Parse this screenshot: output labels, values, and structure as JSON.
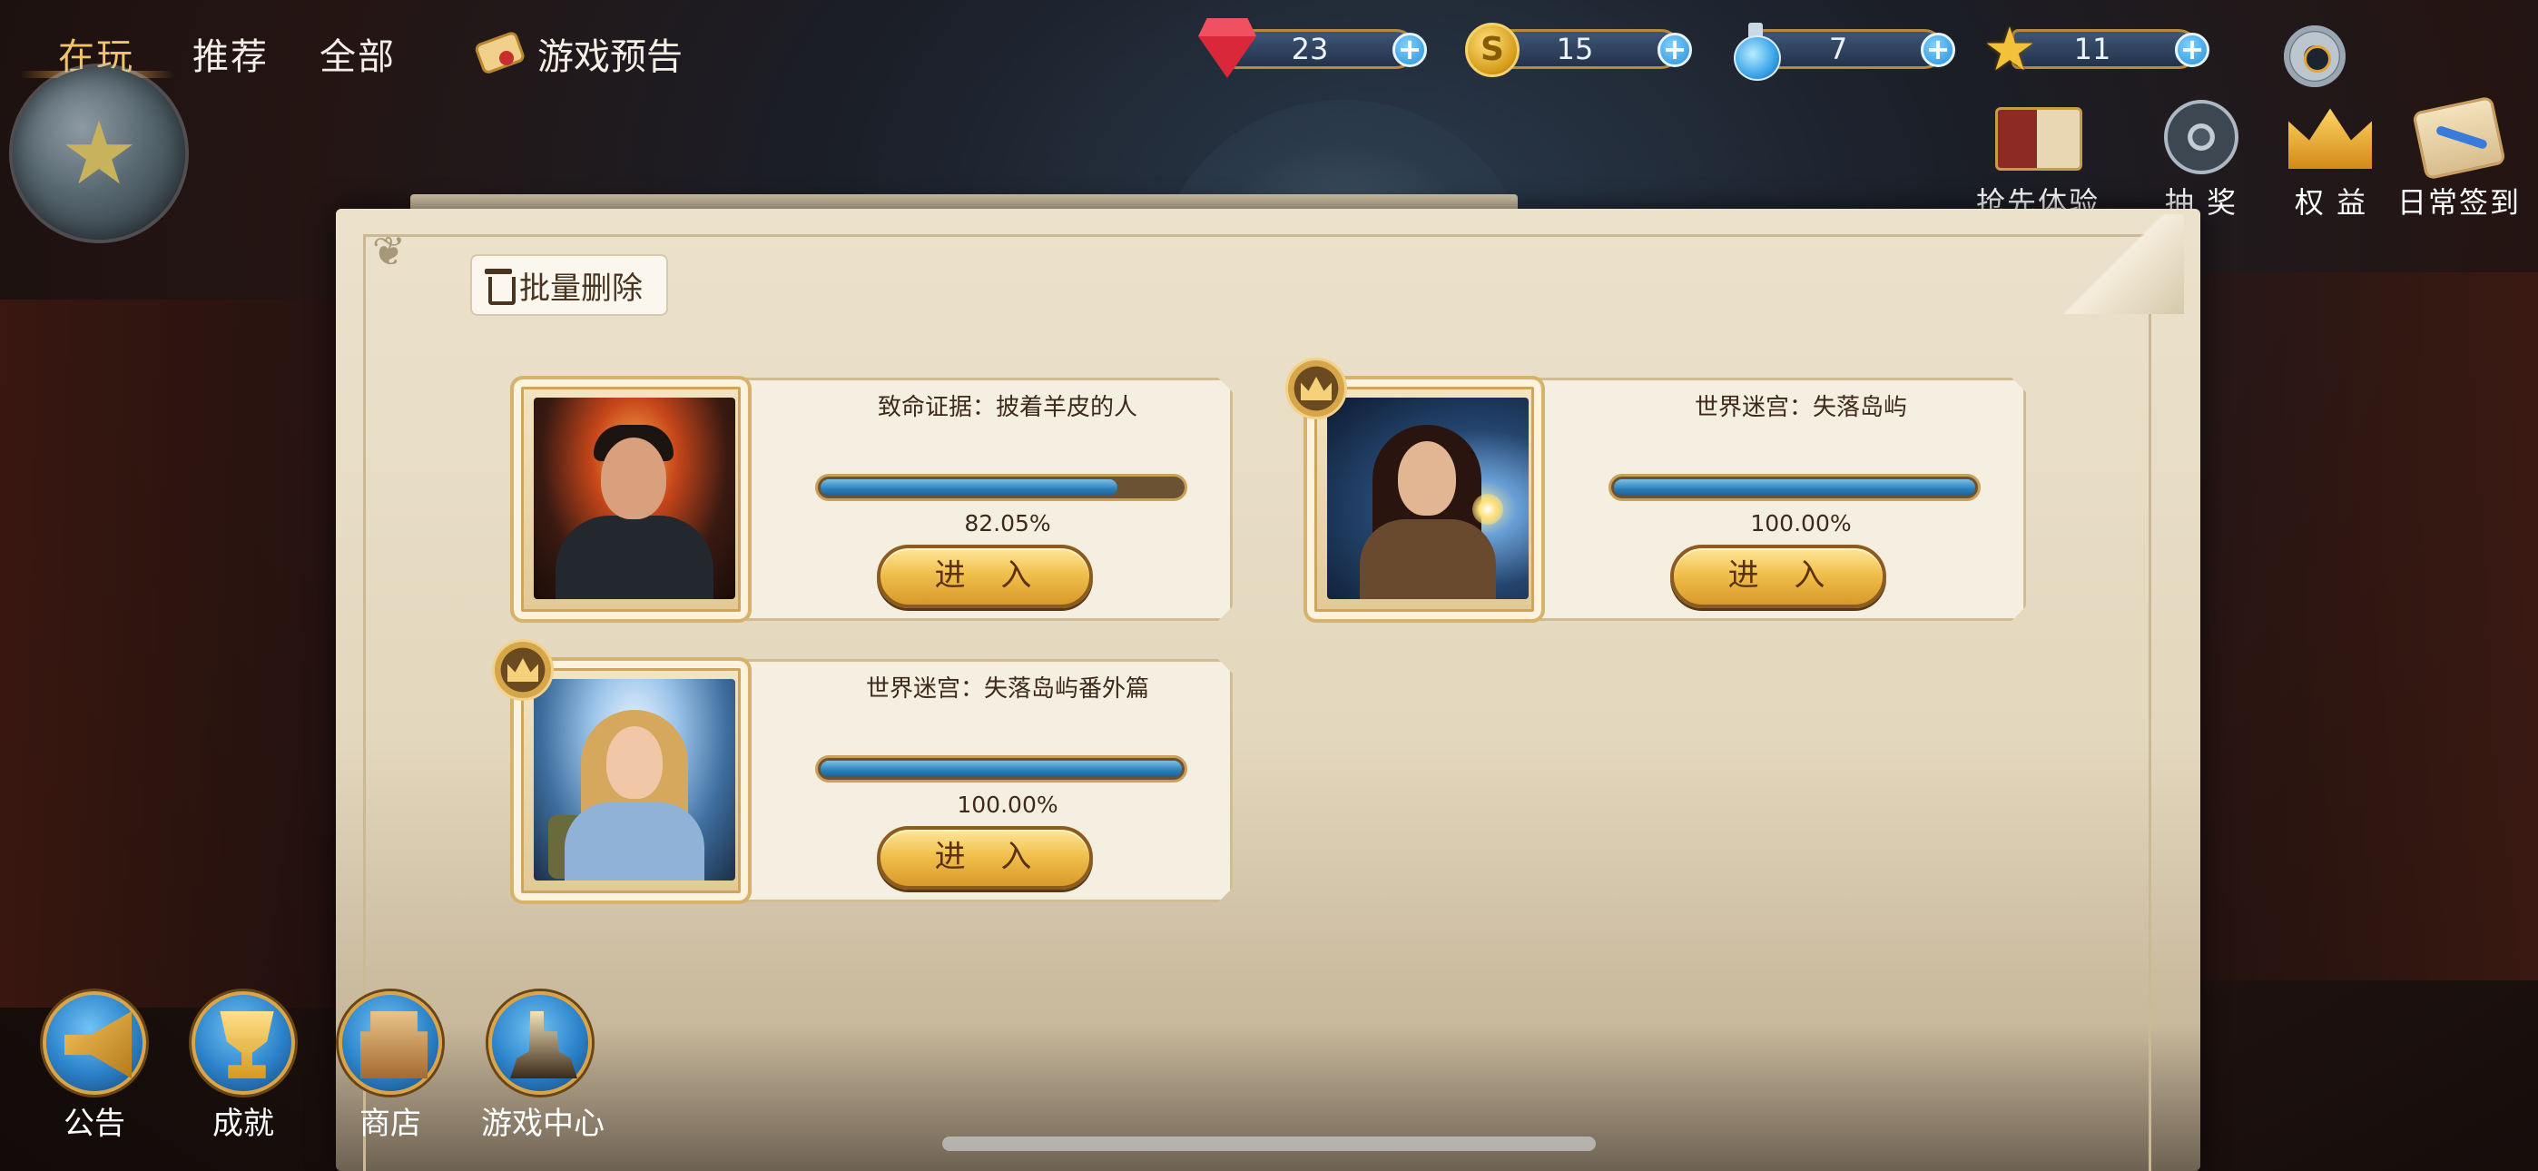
{
  "tabs": [
    {
      "label": "在玩",
      "active": true
    },
    {
      "label": "推荐",
      "active": false
    },
    {
      "label": "全部",
      "active": false
    }
  ],
  "preview_tab": {
    "label": "游戏预告",
    "icon": "scroll-icon"
  },
  "currencies": [
    {
      "icon": "ruby-gem-icon",
      "value": "23"
    },
    {
      "icon": "gold-coin-icon",
      "value": "15"
    },
    {
      "icon": "potion-icon",
      "value": "7"
    },
    {
      "icon": "star-icon",
      "value": "11"
    }
  ],
  "features": [
    {
      "label": "抢先体验",
      "icon": "book-icon"
    },
    {
      "label": "抽 奖",
      "icon": "film-reel-icon"
    },
    {
      "label": "权 益",
      "icon": "crown-icon"
    },
    {
      "label": "日常签到",
      "icon": "scroll-quill-icon"
    }
  ],
  "batch_delete_label": "批量删除",
  "games": [
    {
      "title": "致命证据：披着羊皮的人",
      "progress": 82.05,
      "progress_label": "82.05%",
      "enter_label": "进 入",
      "vip": false
    },
    {
      "title": "世界迷宫：失落岛屿",
      "progress": 100,
      "progress_label": "100.00%",
      "enter_label": "进 入",
      "vip": true
    },
    {
      "title": "世界迷宫：失落岛屿番外篇",
      "progress": 100,
      "progress_label": "100.00%",
      "enter_label": "进 入",
      "vip": true
    }
  ],
  "bottom_nav": [
    {
      "label": "公告",
      "icon": "megaphone-icon"
    },
    {
      "label": "成就",
      "icon": "trophy-icon"
    },
    {
      "label": "商店",
      "icon": "cash-register-icon"
    },
    {
      "label": "游戏中心",
      "icon": "chess-icon"
    }
  ],
  "colors": {
    "accent_gold": "#f2c46a",
    "progress_blue": "#2a7fba",
    "paper": "#ece2cc"
  }
}
